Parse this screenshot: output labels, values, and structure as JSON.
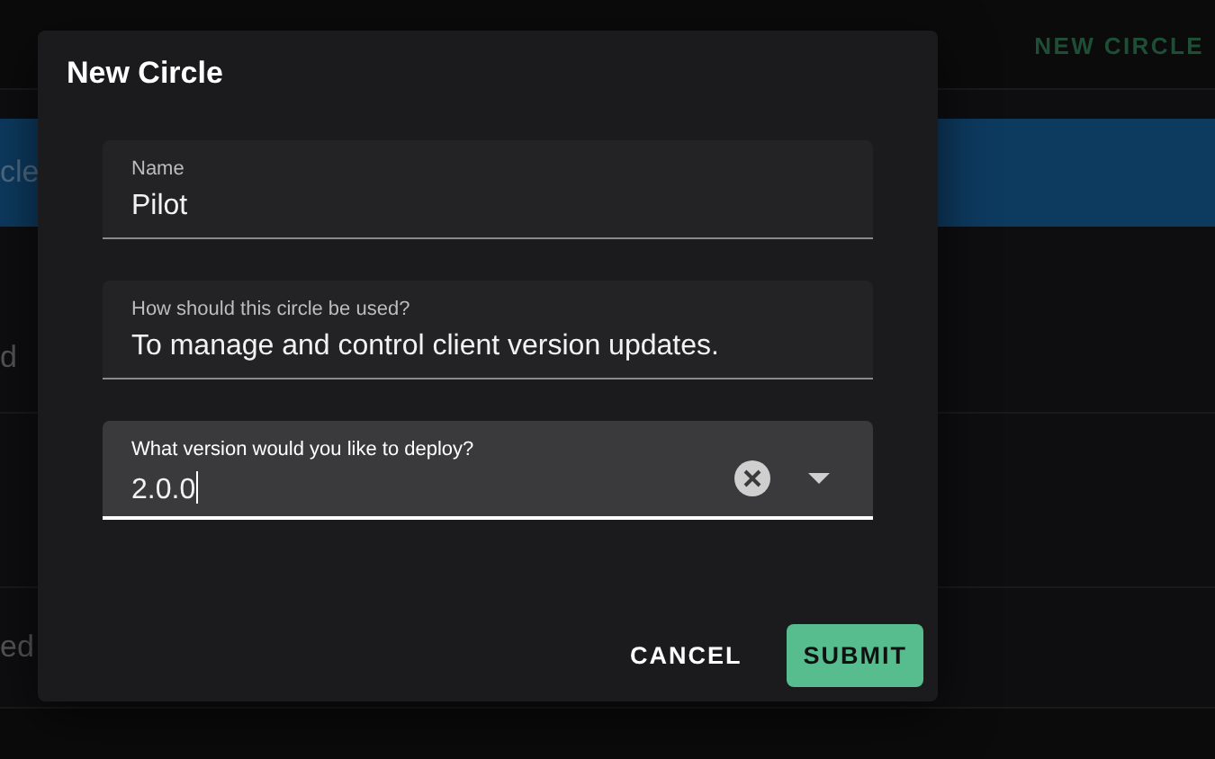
{
  "background": {
    "action_button": "NEW CIRCLE",
    "banner_text": "cle",
    "row_texts": [
      "d",
      "ed"
    ]
  },
  "dialog": {
    "title": "New Circle",
    "fields": [
      {
        "kind": "text",
        "label": "Name",
        "value": "Pilot",
        "focused": false
      },
      {
        "kind": "text",
        "label": "How should this circle be used?",
        "value": "To manage and control client version updates.",
        "focused": false
      },
      {
        "kind": "autocomplete",
        "label": "What version would you like to deploy?",
        "value": "2.0.0",
        "focused": true
      }
    ],
    "buttons": [
      {
        "label": "CANCEL",
        "kind": "text"
      },
      {
        "label": "SUBMIT",
        "kind": "contained"
      }
    ]
  }
}
